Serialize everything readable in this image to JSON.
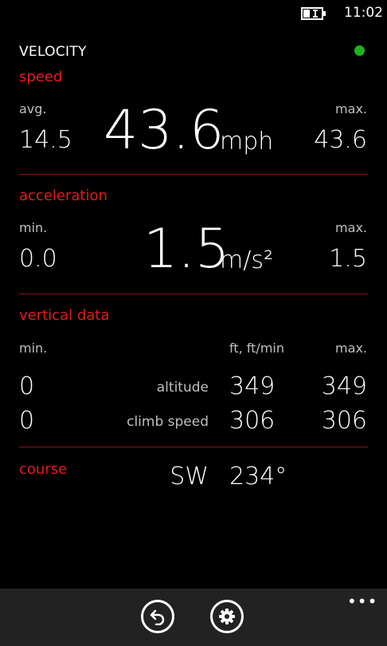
{
  "status": {
    "time": "11:02"
  },
  "app": {
    "title": "VELOCITY",
    "gps_color": "#1db31d",
    "accent": "#e31b1b"
  },
  "speed": {
    "header": "speed",
    "avg_label": "avg.",
    "avg_value": "14.5",
    "current": "43.6",
    "unit": "mph",
    "max_label": "max.",
    "max_value": "43.6"
  },
  "acceleration": {
    "header": "acceleration",
    "min_label": "min.",
    "min_value": "0.0",
    "current": "1.5",
    "unit": "m/s²",
    "max_label": "max.",
    "max_value": "1.5"
  },
  "vertical": {
    "header": "vertical data",
    "min_label": "min.",
    "units_label": "ft, ft/min",
    "max_label": "max.",
    "rows": [
      {
        "min": "0",
        "label": "altitude",
        "current": "349",
        "max": "349"
      },
      {
        "min": "0",
        "label": "climb speed",
        "current": "306",
        "max": "306"
      }
    ]
  },
  "course": {
    "header": "course",
    "direction": "SW",
    "degrees": "234°"
  },
  "appbar": {
    "more": "•••",
    "icons": [
      "back-arrow-icon",
      "gear-icon"
    ]
  }
}
